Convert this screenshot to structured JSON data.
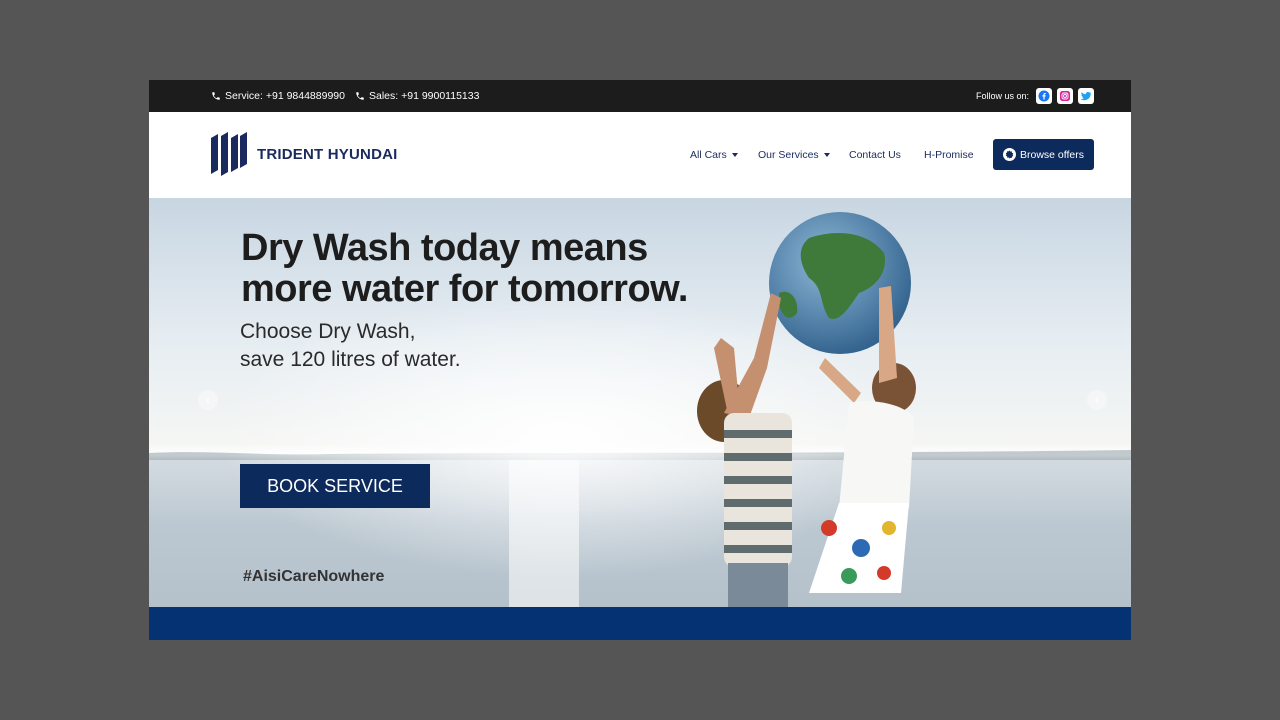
{
  "topbar": {
    "service": "Service: +91 9844889990",
    "sales": "Sales: +91 9900115133",
    "follow_label": "Follow us on:",
    "social": [
      "facebook-icon",
      "instagram-icon",
      "twitter-icon"
    ]
  },
  "header": {
    "brand": "TRIDENT HYUNDAI",
    "nav": [
      {
        "label": "All Cars",
        "dropdown": true
      },
      {
        "label": "Our Services",
        "dropdown": true
      },
      {
        "label": "Contact Us",
        "dropdown": false
      },
      {
        "label": "H-Promise",
        "dropdown": false
      }
    ],
    "browse_label": "Browse offers"
  },
  "hero": {
    "headline_line1": "Dry Wash today means",
    "headline_line2": "more water for tomorrow.",
    "sub_line1": "Choose Dry Wash,",
    "sub_line2": "save 120 litres of water.",
    "cta": "BOOK SERVICE",
    "hashtag": "#AisiCareNowhere",
    "prev_icon": "chevron-left-icon",
    "next_icon": "chevron-right-icon"
  },
  "colors": {
    "topbar": "#1c1c1c",
    "brand_navy": "#0d2a5c",
    "band": "#043272",
    "background": "#555555"
  }
}
